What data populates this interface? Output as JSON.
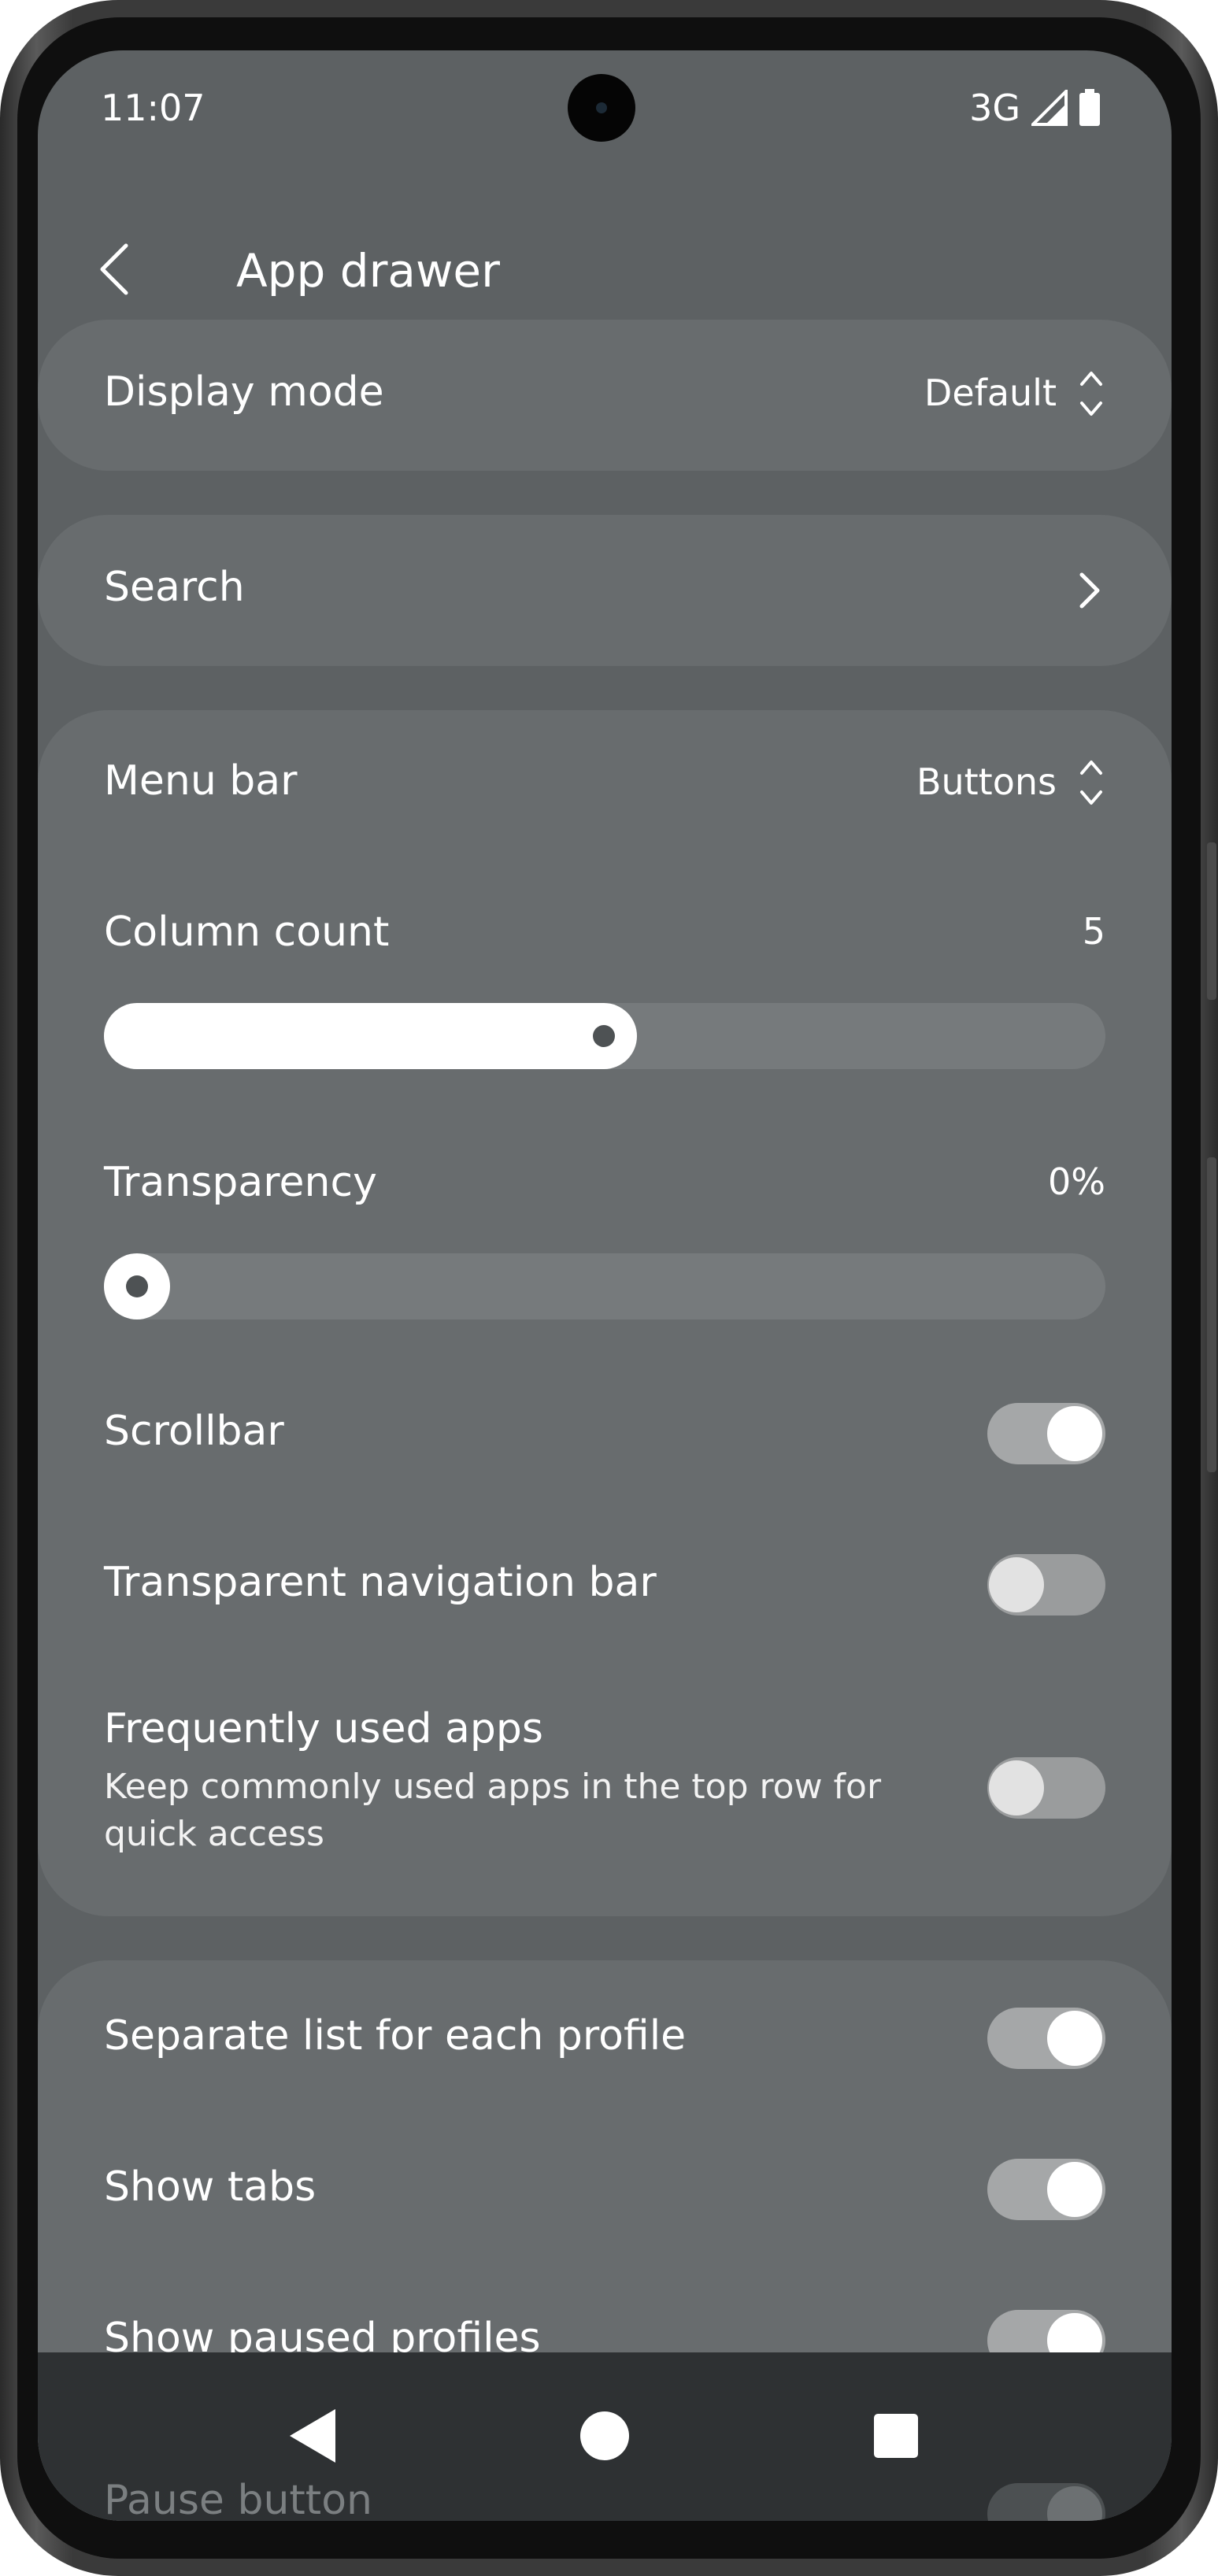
{
  "status_bar": {
    "time": "11:07",
    "network": "3G"
  },
  "app_bar": {
    "title": "App drawer"
  },
  "settings": {
    "display_mode": {
      "label": "Display mode",
      "value": "Default"
    },
    "search": {
      "label": "Search"
    },
    "menu_bar": {
      "label": "Menu bar",
      "value": "Buttons"
    },
    "column_count": {
      "label": "Column count",
      "value": "5",
      "slider_fraction": 0.52
    },
    "transparency": {
      "label": "Transparency",
      "value": "0%",
      "slider_fraction": 0.0
    },
    "scrollbar": {
      "label": "Scrollbar",
      "enabled": true
    },
    "transparent_navigation_bar": {
      "label": "Transparent navigation bar",
      "enabled": false
    },
    "frequently_used_apps": {
      "label": "Frequently used apps",
      "summary": "Keep commonly used apps in the top row for quick access",
      "enabled": false
    },
    "separate_list": {
      "label": "Separate list for each profile",
      "enabled": true
    },
    "show_tabs": {
      "label": "Show tabs",
      "enabled": true
    },
    "show_paused_profiles": {
      "label": "Show paused profiles",
      "enabled": true
    },
    "pause_button": {
      "label": "Pause button"
    }
  },
  "icons": {
    "back": "arrow-back-icon",
    "spinner": "unfold-icon",
    "chevron": "chevron-right-icon",
    "signal": "signal-icon",
    "battery": "battery-icon",
    "nav_back": "nav-back-icon",
    "nav_home": "nav-home-icon",
    "nav_recent": "nav-recent-icon"
  },
  "colors": {
    "background": "#5d6163",
    "card": "#686c6e",
    "navbar": "#2e3133"
  }
}
